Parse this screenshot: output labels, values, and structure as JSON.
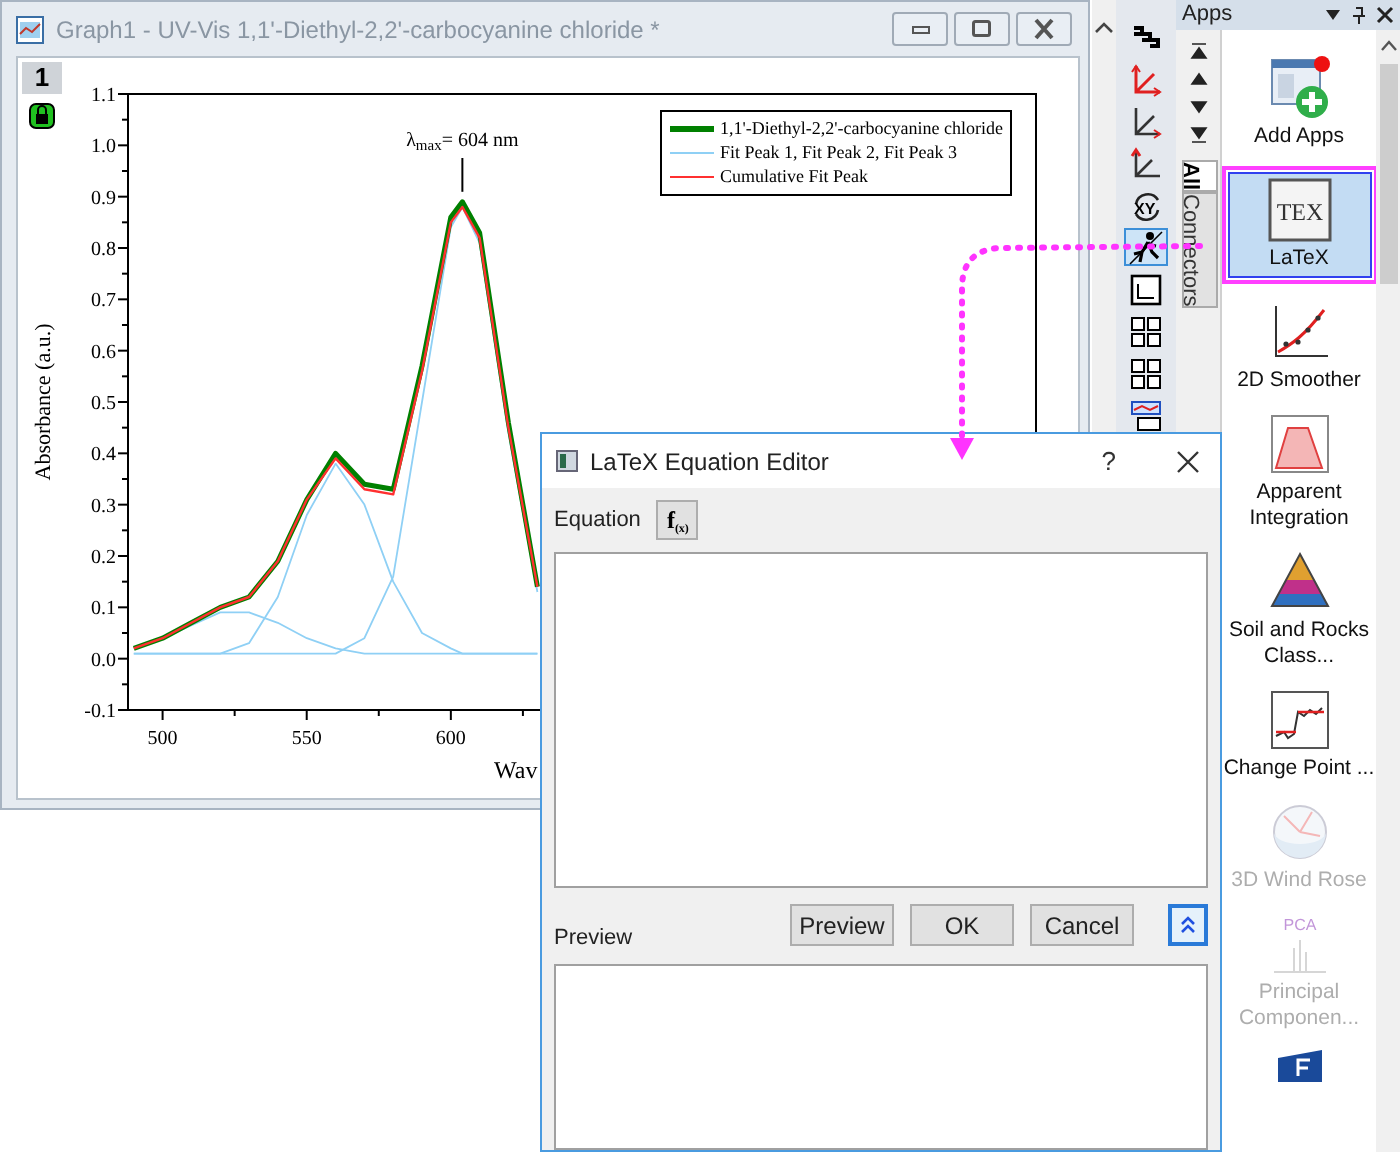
{
  "graph_window": {
    "title": "Graph1 - UV-Vis 1,1'-Diethyl-2,2'-carbocyanine chloride *",
    "layer_tab": "1",
    "chart_data": {
      "type": "line",
      "xlabel": "Wav",
      "ylabel": "Absorbance (a.u.)",
      "legend": true,
      "x": [
        490,
        500,
        510,
        520,
        530,
        540,
        550,
        560,
        570,
        580,
        590,
        600,
        604,
        610,
        620,
        630
      ],
      "series": [
        {
          "name": "1,1'-Diethyl-2,2'-carbocyanine chloride",
          "color": "#008000",
          "values": [
            0.02,
            0.04,
            0.07,
            0.1,
            0.12,
            0.19,
            0.31,
            0.4,
            0.34,
            0.33,
            0.57,
            0.86,
            0.89,
            0.83,
            0.46,
            0.14
          ]
        },
        {
          "name": "Fit Peak 1,",
          "color": "#8fd0f5",
          "values": [
            0.02,
            0.04,
            null,
            0.09,
            0.09,
            0.07,
            0.04,
            0.02,
            0.01,
            0.01,
            0.01,
            0.01,
            0.01,
            0.01,
            0.01,
            0.01
          ]
        },
        {
          "name": "Fit Peak 2,",
          "color": "#8fd0f5",
          "values": [
            0.01,
            0.01,
            0.01,
            0.01,
            0.03,
            0.12,
            0.28,
            0.38,
            0.3,
            0.15,
            0.05,
            0.02,
            0.01,
            0.01,
            0.01,
            0.01
          ]
        },
        {
          "name": "Fit Peak 3",
          "color": "#8fd0f5",
          "values": [
            0.01,
            0.01,
            0.01,
            0.01,
            0.01,
            0.01,
            0.01,
            0.01,
            0.04,
            0.16,
            0.5,
            0.84,
            0.88,
            0.81,
            0.44,
            0.13
          ]
        },
        {
          "name": "Cumulative Fit Peak",
          "color": "#ff3030",
          "values": [
            0.02,
            0.04,
            0.07,
            0.1,
            0.12,
            0.19,
            0.31,
            0.39,
            0.33,
            0.32,
            0.56,
            0.85,
            0.88,
            0.82,
            0.45,
            0.14
          ]
        }
      ],
      "xlim": [
        488,
        803
      ],
      "ylim": [
        -0.1,
        1.1
      ],
      "xticks": [
        500,
        550,
        600
      ],
      "yticks": [
        -0.1,
        {
          "value": 0,
          "label": "0.0"
        },
        0.1,
        0.2,
        0.3,
        0.4,
        0.5,
        0.6,
        0.7,
        0.8,
        0.9,
        {
          "value": 1,
          "label": "1.0"
        },
        1.1
      ],
      "annotations": [
        {
          "text": "λ$_{max}$= 604 nm",
          "x": 604,
          "y": 0.89
        }
      ]
    }
  },
  "toolbar": {
    "tools": [
      {
        "kind": "layers",
        "selected": false
      },
      {
        "kind": "axes-red",
        "selected": false
      },
      {
        "kind": "axes",
        "selected": false
      },
      {
        "kind": "axis-red",
        "selected": false
      },
      {
        "kind": "swap",
        "text": "XY",
        "selected": false
      },
      {
        "kind": "runner",
        "selected": true
      },
      {
        "kind": "frame",
        "selected": false
      },
      {
        "kind": "grid",
        "selected": false
      },
      {
        "kind": "grid",
        "selected": false
      },
      {
        "kind": "stack",
        "selected": false
      }
    ]
  },
  "apps_panel": {
    "title": "Apps",
    "tabs": [
      {
        "label": "All",
        "selected": true
      },
      {
        "label": "Connectors",
        "selected": false
      }
    ],
    "apps": [
      {
        "kind": "add",
        "label": "Add Apps",
        "selected": false,
        "disabled": false
      },
      {
        "kind": "tex",
        "icon_text": "TEX",
        "label": "LaTeX",
        "selected": true,
        "disabled": false
      },
      {
        "kind": "smoother",
        "label": "2D Smoother",
        "selected": false,
        "disabled": false
      },
      {
        "kind": "integration",
        "label": "Apparent Integration",
        "selected": false,
        "disabled": false
      },
      {
        "kind": "soil",
        "label": "Soil and Rocks Class...",
        "selected": false,
        "disabled": false
      },
      {
        "kind": "changepoint",
        "label": "Change Point ...",
        "selected": false,
        "disabled": false
      },
      {
        "kind": "windrose",
        "label": "3D Wind Rose",
        "selected": false,
        "disabled": true
      },
      {
        "kind": "pca",
        "icon_text": "PCA",
        "label": "Principal Componen...",
        "selected": false,
        "disabled": true
      },
      {
        "kind": "file",
        "selected": false,
        "disabled": false
      }
    ]
  },
  "dialog": {
    "title": "LaTeX Equation Editor",
    "help": "?",
    "equation_label": "Equation",
    "function_button": "f$_{(x)}$",
    "preview_label": "Preview",
    "buttons": [
      {
        "label": "Preview"
      },
      {
        "label": "OK"
      },
      {
        "label": "Cancel"
      }
    ]
  }
}
